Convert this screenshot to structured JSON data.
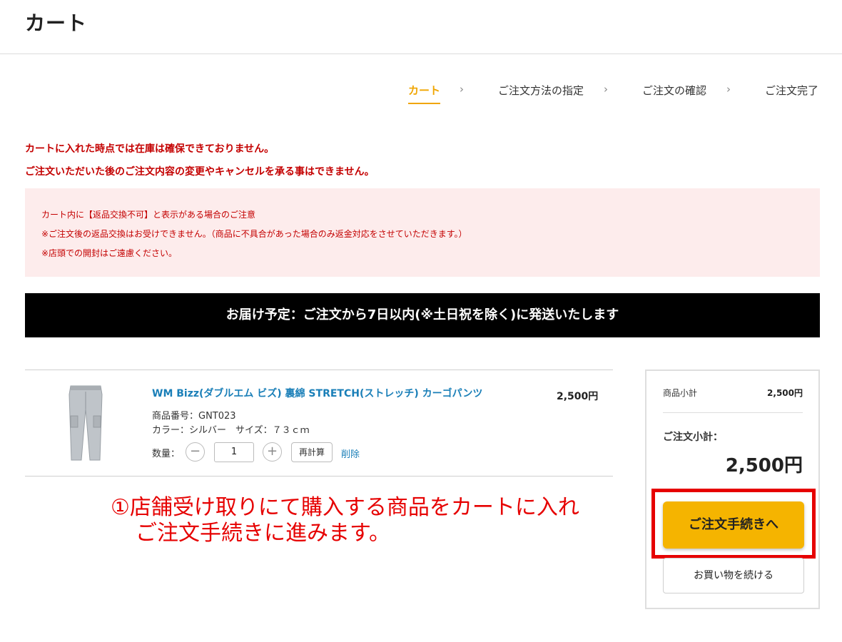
{
  "page": {
    "title": "カート"
  },
  "steps": [
    {
      "label": "カート",
      "active": true
    },
    {
      "label": "ご注文方法の指定",
      "active": false
    },
    {
      "label": "ご注文の確認",
      "active": false
    },
    {
      "label": "ご注文完了",
      "active": false
    }
  ],
  "step_separator": "›",
  "warnings": [
    "カートに入れた時点では在庫は確保できておりません。",
    "ご注文いただいた後のご注文内容の変更やキャンセルを承る事はできません。"
  ],
  "notice": {
    "lines": [
      "カート内に【返品交換不可】と表示がある場合のご注意",
      "※ご注文後の返品交換はお受けできません。（商品に不具合があった場合のみ返金対応をさせていただきます。）",
      "※店頭での開封はご遠慮ください。"
    ]
  },
  "delivery_notice": "お届け予定：ご注文から7日以内(※土日祝を除く)に発送いたします",
  "cart_item": {
    "name": "WM Bizz(ダブルエム ビズ) 裏綿 STRETCH(ストレッチ) カーゴパンツ",
    "price": "2,500円",
    "product_number": "商品番号：GNT023",
    "variant": "カラー：シルバー　サイズ：７３ｃｍ",
    "quantity_label": "数量：",
    "quantity": "1",
    "minus_symbol": "−",
    "plus_symbol": "+",
    "recalculate_label": "再計算",
    "delete_label": "削除"
  },
  "annotation": {
    "line1": "①店舗受け取りにて購入する商品をカートに入れ",
    "line2": "ご注文手続きに進みます。"
  },
  "summary": {
    "subtotal_label": "商品小計",
    "subtotal_value": "2,500円",
    "order_subtotal_label": "ご注文小計：",
    "order_subtotal_value": "2,500円",
    "checkout_label": "ご注文手続きへ",
    "continue_label": "お買い物を続ける"
  },
  "colors": {
    "accent": "#f5b400",
    "active_step": "#f0a500",
    "warning": "#c40000",
    "notice_bg": "#fdecec",
    "link": "#1a7fb8",
    "annotation": "#e60000"
  }
}
